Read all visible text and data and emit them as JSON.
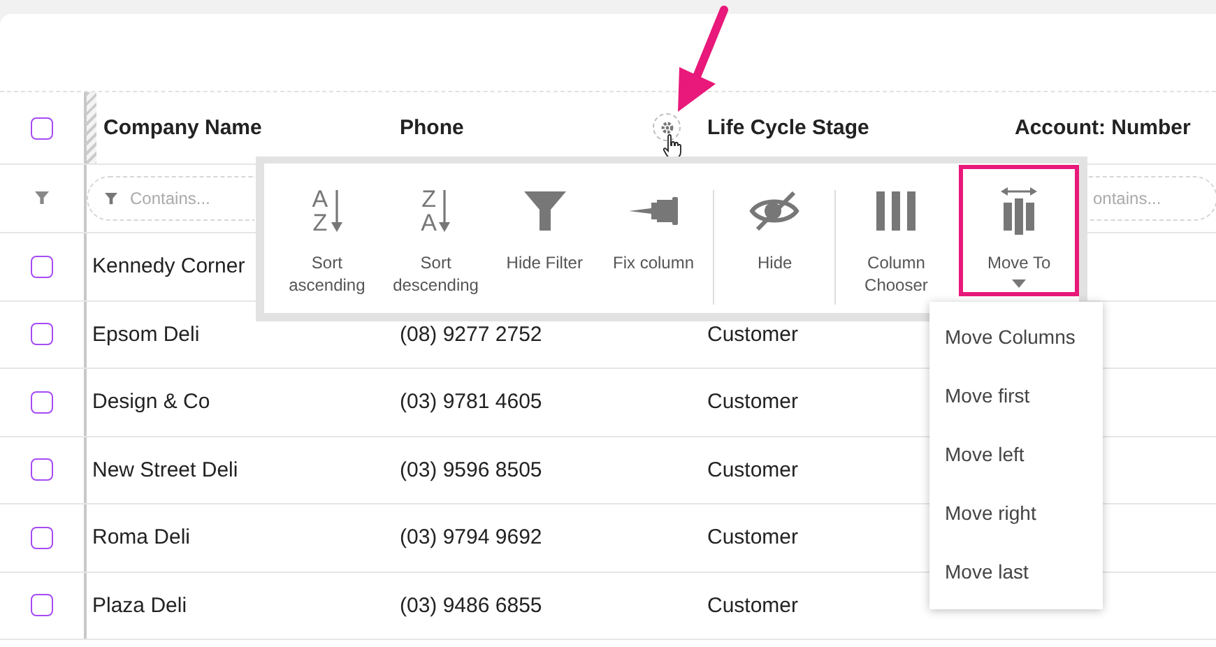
{
  "header_checkbox": {
    "checked": false
  },
  "columns": [
    {
      "label": "Company Name",
      "filter_placeholder": "Contains..."
    },
    {
      "label": "Phone"
    },
    {
      "label": "Life Cycle Stage"
    },
    {
      "label": "Account: Number",
      "filter_placeholder": "ontains..."
    }
  ],
  "rows": [
    {
      "checked": false,
      "company": "Kennedy Corner"
    },
    {
      "checked": false,
      "company": "Epsom Deli",
      "phone": "(08) 9277 2752",
      "stage": "Customer"
    },
    {
      "checked": false,
      "company": "Design & Co",
      "phone": "(03) 9781 4605",
      "stage": "Customer"
    },
    {
      "checked": false,
      "company": "New Street Deli",
      "phone": "(03) 9596 8505",
      "stage": "Customer"
    },
    {
      "checked": false,
      "company": "Roma Deli",
      "phone": "(03) 9794 9692",
      "stage": "Customer"
    },
    {
      "checked": false,
      "company": "Plaza Deli",
      "phone": "(03) 9486 6855",
      "stage": "Customer"
    }
  ],
  "column_menu": {
    "items": [
      {
        "kind": "sort",
        "glyphs": [
          "A",
          "Z"
        ],
        "label": "Sort ascending",
        "selected": false,
        "separator_before": false,
        "dropdown": false
      },
      {
        "kind": "sort",
        "glyphs": [
          "Z",
          "A"
        ],
        "label": "Sort descending",
        "selected": false,
        "separator_before": false,
        "dropdown": false
      },
      {
        "kind": "filter",
        "label": "Hide Filter",
        "selected": false,
        "separator_before": false,
        "dropdown": false
      },
      {
        "kind": "pin",
        "label": "Fix column",
        "selected": false,
        "separator_before": false,
        "dropdown": false
      },
      {
        "kind": "hide",
        "label": "Hide",
        "selected": false,
        "separator_before": true,
        "dropdown": false
      },
      {
        "kind": "columns",
        "label": "Column Chooser",
        "selected": false,
        "separator_before": true,
        "dropdown": false
      },
      {
        "kind": "move",
        "label": "Move To",
        "selected": true,
        "separator_before": false,
        "dropdown": true
      }
    ]
  },
  "move_menu": {
    "items": [
      {
        "label": "Move Columns"
      },
      {
        "label": "Move first"
      },
      {
        "label": "Move left"
      },
      {
        "label": "Move right"
      },
      {
        "label": "Move last"
      }
    ]
  }
}
